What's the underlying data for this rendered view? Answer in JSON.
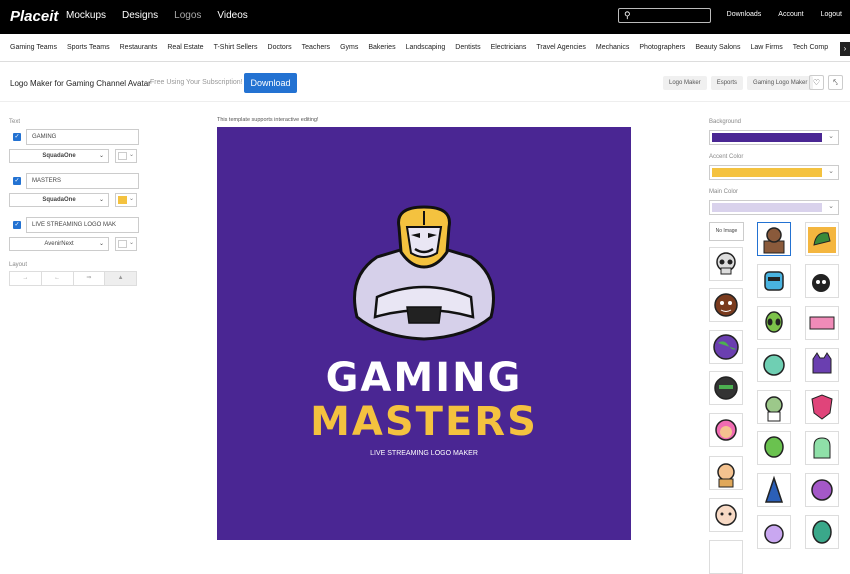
{
  "header": {
    "logo": "Placeit",
    "nav": [
      "Mockups",
      "Designs",
      "Logos",
      "Videos"
    ],
    "right": [
      "Downloads",
      "Account",
      "Logout"
    ]
  },
  "categories": [
    "Gaming Teams",
    "Sports Teams",
    "Restaurants",
    "Real Estate",
    "T-Shirt Sellers",
    "Doctors",
    "Teachers",
    "Gyms",
    "Bakeries",
    "Landscaping",
    "Dentists",
    "Electricians",
    "Travel Agencies",
    "Mechanics",
    "Photographers",
    "Beauty Salons",
    "Law Firms",
    "Tech Comp"
  ],
  "page": {
    "title": "Logo Maker for Gaming Channel Avatar",
    "subtitle": "Free Using Your Subscription!",
    "download_label": "Download",
    "tags": [
      "Logo Maker",
      "Esports",
      "Gaming Logo Maker"
    ]
  },
  "editor": {
    "text_label": "Text",
    "fields": [
      {
        "value": "GAMING",
        "font": "SquadaOne",
        "color": "#ffffff"
      },
      {
        "value": "MASTERS",
        "font": "SquadaOne",
        "color": "#f4c23f"
      },
      {
        "value": "LIVE STREAMING LOGO MAK",
        "font": "AvenirNext",
        "color": "#ffffff"
      }
    ],
    "layout_label": "Layout"
  },
  "canvas": {
    "note": "This template supports interactive editing!",
    "line1": "GAMING",
    "line2": "MASTERS",
    "line3": "LIVE STREAMING LOGO MAKER",
    "bg": "#4a2693",
    "accent": "#f4c23f"
  },
  "colors": {
    "background_label": "Background",
    "background": "#4a2693",
    "accent_label": "Accent Color",
    "accent": "#f4c23f",
    "main_label": "Main Color",
    "main": "#d9d2ec"
  },
  "gallery": {
    "no_image_label": "No Image"
  }
}
